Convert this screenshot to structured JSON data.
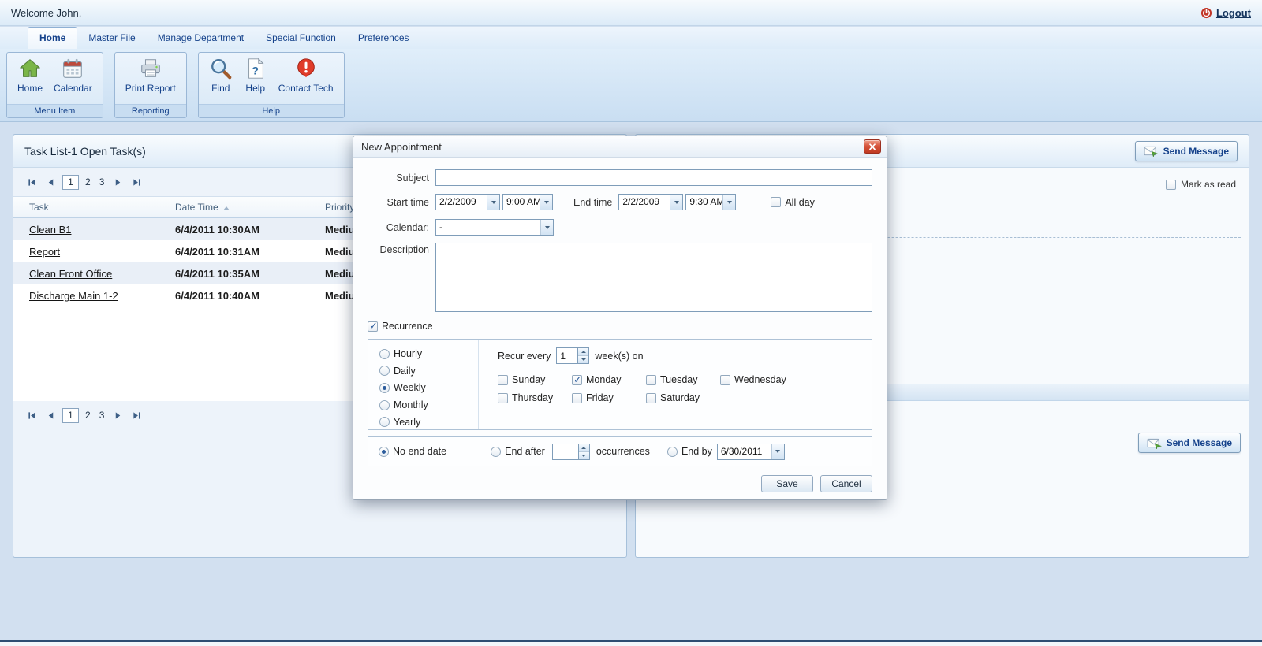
{
  "topbar": {
    "welcome": "Welcome John,",
    "logout": "Logout"
  },
  "tabs": {
    "items": [
      {
        "label": "Home"
      },
      {
        "label": "Master File"
      },
      {
        "label": "Manage Department"
      },
      {
        "label": "Special Function"
      },
      {
        "label": "Preferences"
      }
    ]
  },
  "ribbon": {
    "groups": [
      {
        "label": "Menu Item"
      },
      {
        "label": "Reporting"
      },
      {
        "label": "Help"
      }
    ],
    "buttons": {
      "home": "Home",
      "calendar": "Calendar",
      "print_report": "Print Report",
      "find": "Find",
      "help": "Help",
      "contact_tech": "Contact Tech"
    }
  },
  "tasks": {
    "title": "Task List-1 Open Task(s)",
    "pages": [
      "1",
      "2",
      "3"
    ],
    "columns": {
      "task": "Task",
      "datetime": "Date Time",
      "priority": "Priority"
    },
    "rows": [
      {
        "task": "Clean B1",
        "datetime": "6/4/2011 10:30AM",
        "priority": "Medium"
      },
      {
        "task": "Report",
        "datetime": "6/4/2011 10:31AM",
        "priority": "Medium"
      },
      {
        "task": "Clean Front Office",
        "datetime": "6/4/2011 10:35AM",
        "priority": "Medium"
      },
      {
        "task": "Discharge Main 1-2",
        "datetime": "6/4/2011 10:40AM",
        "priority": "Medium"
      }
    ]
  },
  "messages": {
    "send_message": "Send Message",
    "mark_as_read": "Mark as read",
    "mark_as_read_checked": false
  },
  "dialog": {
    "title": "New Appointment",
    "labels": {
      "subject": "Subject",
      "start_time": "Start time",
      "end_time": "End time",
      "all_day": "All day",
      "calendar": "Calendar:",
      "description": "Description",
      "recurrence": "Recurrence",
      "recur_every": "Recur every",
      "week_on": "week(s) on",
      "no_end_date": "No end date",
      "end_after": "End after",
      "occurrences": "occurrences",
      "end_by": "End by"
    },
    "values": {
      "subject": "",
      "start_date": "2/2/2009",
      "start_time": "9:00 AM",
      "end_date": "2/2/2009",
      "end_time": "9:30 AM",
      "all_day_checked": false,
      "calendar": "-",
      "description": "",
      "recurrence_checked": true,
      "recur_every": "1",
      "end_after_occurrences": "",
      "end_by_date": "6/30/2011",
      "no_end_date_selected": true,
      "end_after_selected": false,
      "end_by_selected": false
    },
    "frequency": [
      {
        "label": "Hourly",
        "selected": false
      },
      {
        "label": "Daily",
        "selected": false
      },
      {
        "label": "Weekly",
        "selected": true
      },
      {
        "label": "Monthly",
        "selected": false
      },
      {
        "label": "Yearly",
        "selected": false
      }
    ],
    "days": [
      {
        "label": "Sunday",
        "checked": false
      },
      {
        "label": "Monday",
        "checked": true
      },
      {
        "label": "Tuesday",
        "checked": false
      },
      {
        "label": "Wednesday",
        "checked": false
      },
      {
        "label": "Thursday",
        "checked": false
      },
      {
        "label": "Friday",
        "checked": false
      },
      {
        "label": "Saturday",
        "checked": false
      }
    ],
    "buttons": {
      "save": "Save",
      "cancel": "Cancel"
    }
  }
}
